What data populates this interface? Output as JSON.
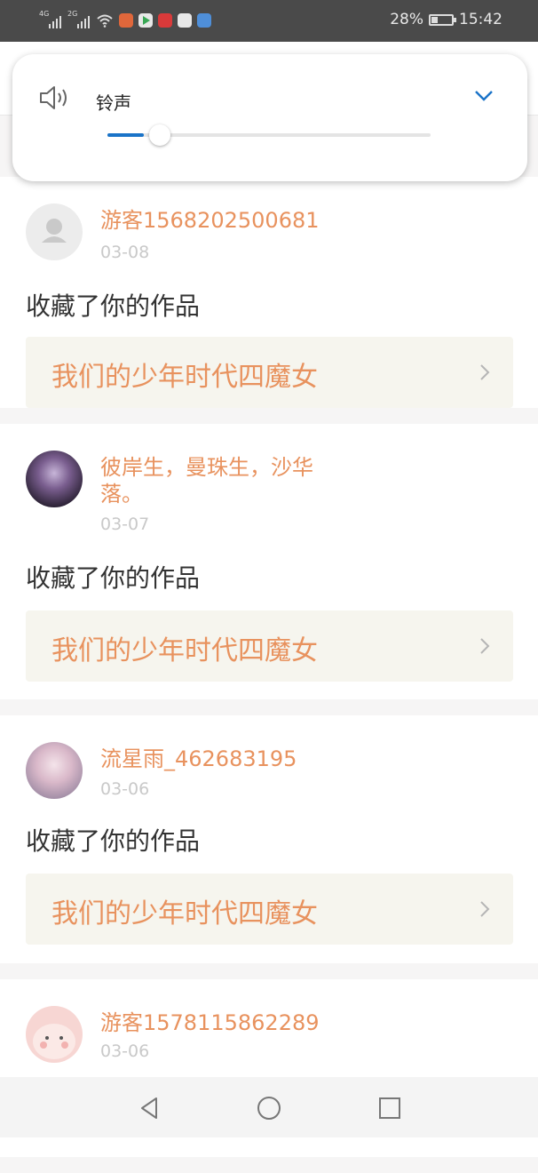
{
  "status_bar": {
    "left_indicators": [
      "4G",
      "2G"
    ],
    "battery": "28%",
    "battery_level": 0.28,
    "time": "15:42",
    "app_icons": [
      "browser-icon",
      "video-icon",
      "heart-app-icon",
      "weibo-icon",
      "news-app-icon"
    ]
  },
  "volume_popup": {
    "label": "铃声",
    "icon": "speaker-icon",
    "expand_icon": "chevron-down-icon",
    "level": 0.08,
    "accent": "#1a73c8"
  },
  "notifications": [
    {
      "user": "游客1568202500681",
      "date": "03-08",
      "action": "收藏了你的作品",
      "work": "我们的少年时代四魔女",
      "avatar": "default-avatar-icon"
    },
    {
      "user": "彼岸生，曼珠生，沙华落。",
      "date": "03-07",
      "action": "收藏了你的作品",
      "work": "我们的少年时代四魔女",
      "avatar": "user-photo"
    },
    {
      "user": "流星雨_462683195",
      "date": "03-06",
      "action": "收藏了你的作品",
      "work": "我们的少年时代四魔女",
      "avatar": "user-photo"
    },
    {
      "user": "游客1578115862289",
      "date": "03-06",
      "action": "",
      "work": "",
      "avatar": "cartoon-avatar"
    }
  ],
  "colors": {
    "accent_orange": "#e8925e",
    "work_bg": "#f6f5ee"
  },
  "nav_bar": [
    "back-icon",
    "home-icon",
    "recents-icon"
  ]
}
